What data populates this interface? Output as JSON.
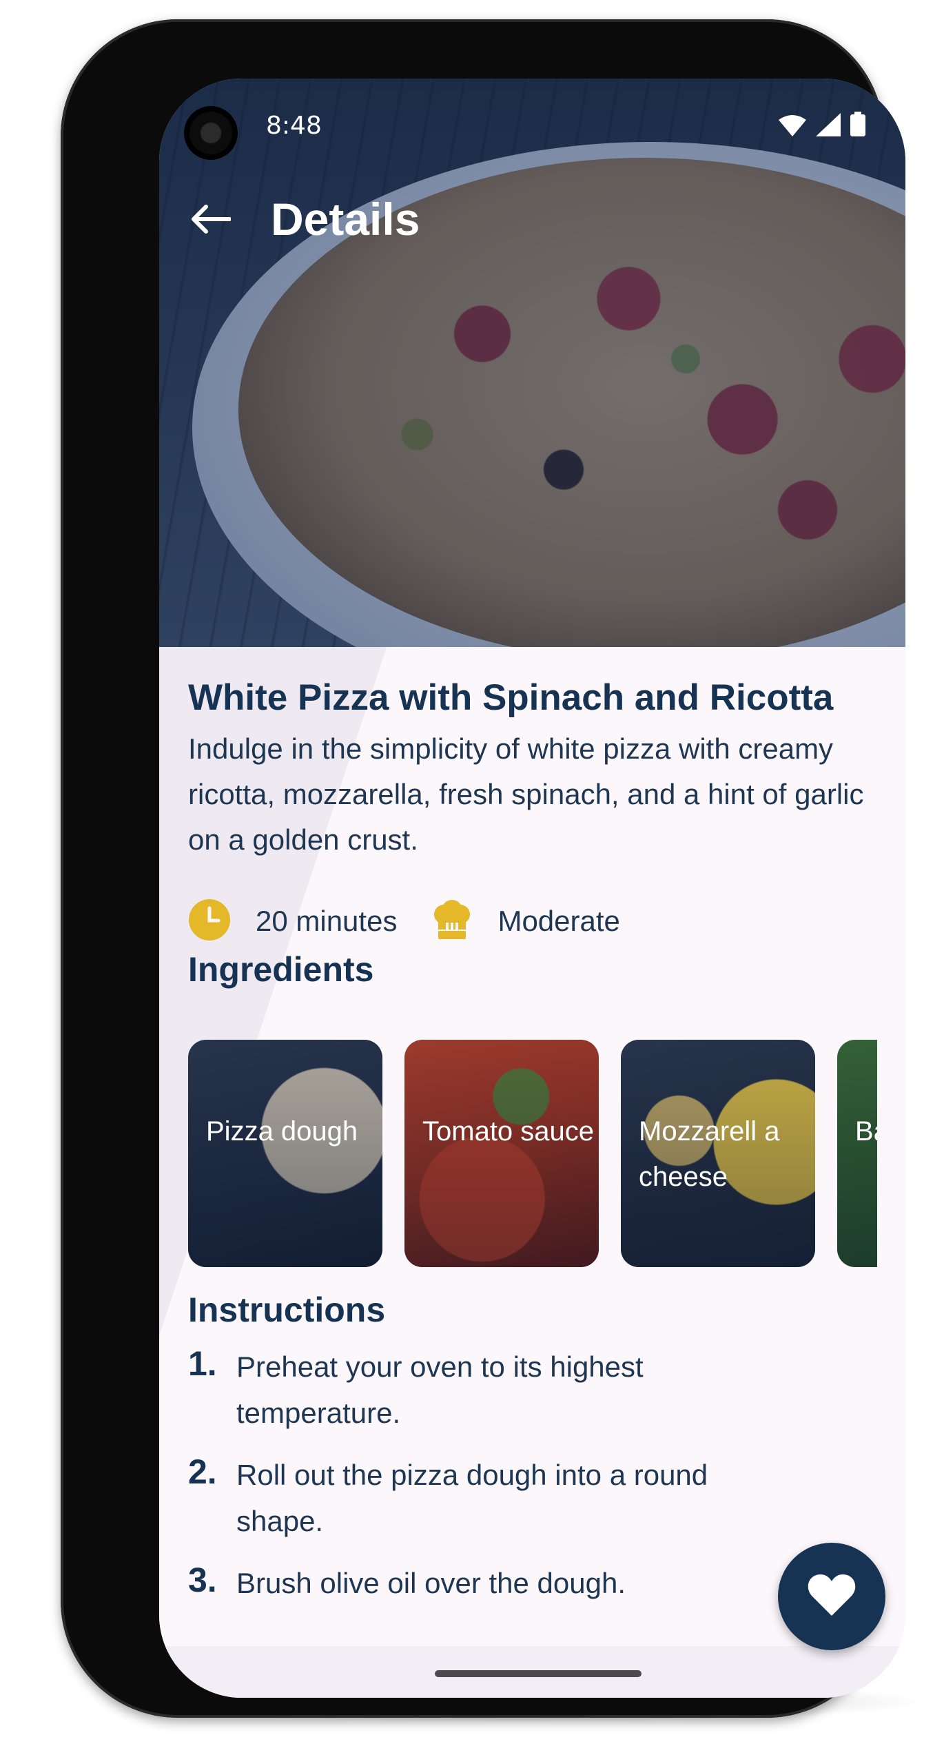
{
  "status_bar": {
    "time": "8:48"
  },
  "app_bar": {
    "title": "Details"
  },
  "recipe": {
    "title": "White Pizza with Spinach and Ricotta",
    "description": "Indulge in the simplicity of white pizza with creamy ricotta, mozzarella, fresh spinach, and a hint of garlic on a golden crust.",
    "time": "20 minutes",
    "difficulty": "Moderate"
  },
  "sections": {
    "ingredients": "Ingredients",
    "instructions": "Instructions"
  },
  "ingredients": [
    {
      "label": "Pizza dough"
    },
    {
      "label": "Tomato sauce"
    },
    {
      "label": "Mozzarell a cheese"
    },
    {
      "label": "Ba lea"
    }
  ],
  "instructions": [
    {
      "num": "1.",
      "text": "Preheat your oven to its highest temperature."
    },
    {
      "num": "2.",
      "text": "Roll out the pizza dough into a round shape."
    },
    {
      "num": "3.",
      "text": "Brush olive oil over the dough."
    }
  ],
  "icons": {
    "back": "arrow-left-icon",
    "time": "clock-icon",
    "difficulty": "chef-hat-icon",
    "favorite": "heart-icon",
    "wifi": "wifi-icon",
    "signal": "cell-signal-icon",
    "battery": "battery-icon"
  },
  "colors": {
    "primary": "#163354",
    "accent": "#E5B82A",
    "background": "#FCF7FB"
  }
}
